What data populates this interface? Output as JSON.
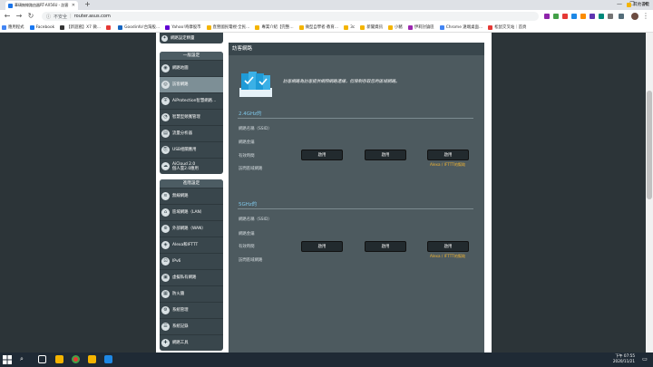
{
  "browser": {
    "tab_title": "華碩無線路由器RT-AX56U - 訪客",
    "new_tab": "+",
    "url_security": "不安全",
    "url": "router.asus.com",
    "window_controls": [
      "—",
      "❐",
      "✕"
    ]
  },
  "bookmarks": [
    {
      "label": "應用程式",
      "color": "#4285f4"
    },
    {
      "label": "Facebook",
      "color": "#1877f2"
    },
    {
      "label": "【新遊窩】X7 微…",
      "color": "#333333"
    },
    {
      "label": "",
      "color": "#e53935"
    },
    {
      "label": "Goodinfo!台灣股…",
      "color": "#1565c0"
    },
    {
      "label": "Yahoo!奇摩股市",
      "color": "#6001d2"
    },
    {
      "label": "直營國民電視‧全民…",
      "color": "#f4b400"
    },
    {
      "label": "專業介紹【完整…",
      "color": "#f4b400"
    },
    {
      "label": "微型自學者‧教育…",
      "color": "#f4b400"
    },
    {
      "label": "3c",
      "color": "#f4b400"
    },
    {
      "label": "新聞資訊",
      "color": "#f4b400"
    },
    {
      "label": "小豬",
      "color": "#f4b400"
    },
    {
      "label": "伊莉討論區",
      "color": "#9c27b0"
    },
    {
      "label": "Chrome 遠端桌面…",
      "color": "#4285f4"
    },
    {
      "label": "松鼠交叉站｜首頁",
      "color": "#e53935"
    }
  ],
  "bookmarks_other": "其他書籤",
  "sidebar": {
    "top_item": "網路設定精靈",
    "general_head": "一般設定",
    "general_items": [
      {
        "icon": "◉",
        "label": "網路地圖"
      },
      {
        "icon": "◎",
        "label": "訪客網路"
      },
      {
        "icon": "⛨",
        "label": "AiProtection智慧網路…"
      },
      {
        "icon": "◔",
        "label": "智慧型頻寬管理"
      },
      {
        "icon": "▤",
        "label": "流量分析器"
      },
      {
        "icon": "⎘",
        "label": "USB相關應用"
      },
      {
        "icon": "☁",
        "label": "AiCloud 2.0\n個人雲2.0應用"
      }
    ],
    "advanced_head": "進階設定",
    "advanced_items": [
      {
        "icon": "≋",
        "label": "無線網路"
      },
      {
        "icon": "⌂",
        "label": "區域網路（LAN）"
      },
      {
        "icon": "⊕",
        "label": "外部網路（WAN）"
      },
      {
        "icon": "◈",
        "label": "Alexa和IFTTT"
      },
      {
        "icon": "⊡",
        "label": "IPv6"
      },
      {
        "icon": "▣",
        "label": "虛擬私有網路"
      },
      {
        "icon": "▦",
        "label": "防火牆"
      },
      {
        "icon": "⚙",
        "label": "系統管理"
      },
      {
        "icon": "☰",
        "label": "系統記錄"
      },
      {
        "icon": "✚",
        "label": "網路工具"
      }
    ]
  },
  "content": {
    "title": "訪客網路",
    "description": "訪客網路為訪客提供網際網路連線，但限制存取您的區域網路。",
    "bands": [
      {
        "name": "2.4GHz的",
        "labels": [
          "網路名稱（SSID）",
          "網路金鑰",
          "有效時間",
          "訪問區域網路"
        ],
        "buttons": [
          "啟用",
          "啟用",
          "啟用"
        ],
        "alexa": "Alexa / IFTTT的幫助"
      },
      {
        "name": "5GHz的",
        "labels": [
          "網路名稱（SSID）",
          "網路金鑰",
          "有效時間",
          "訪問區域網路"
        ],
        "buttons": [
          "啟用",
          "啟用",
          "啟用"
        ],
        "alexa": "Alexa / IFTTT的幫助"
      }
    ]
  },
  "taskbar": {
    "time": "下午 07:55",
    "date": "2020/11/21"
  }
}
